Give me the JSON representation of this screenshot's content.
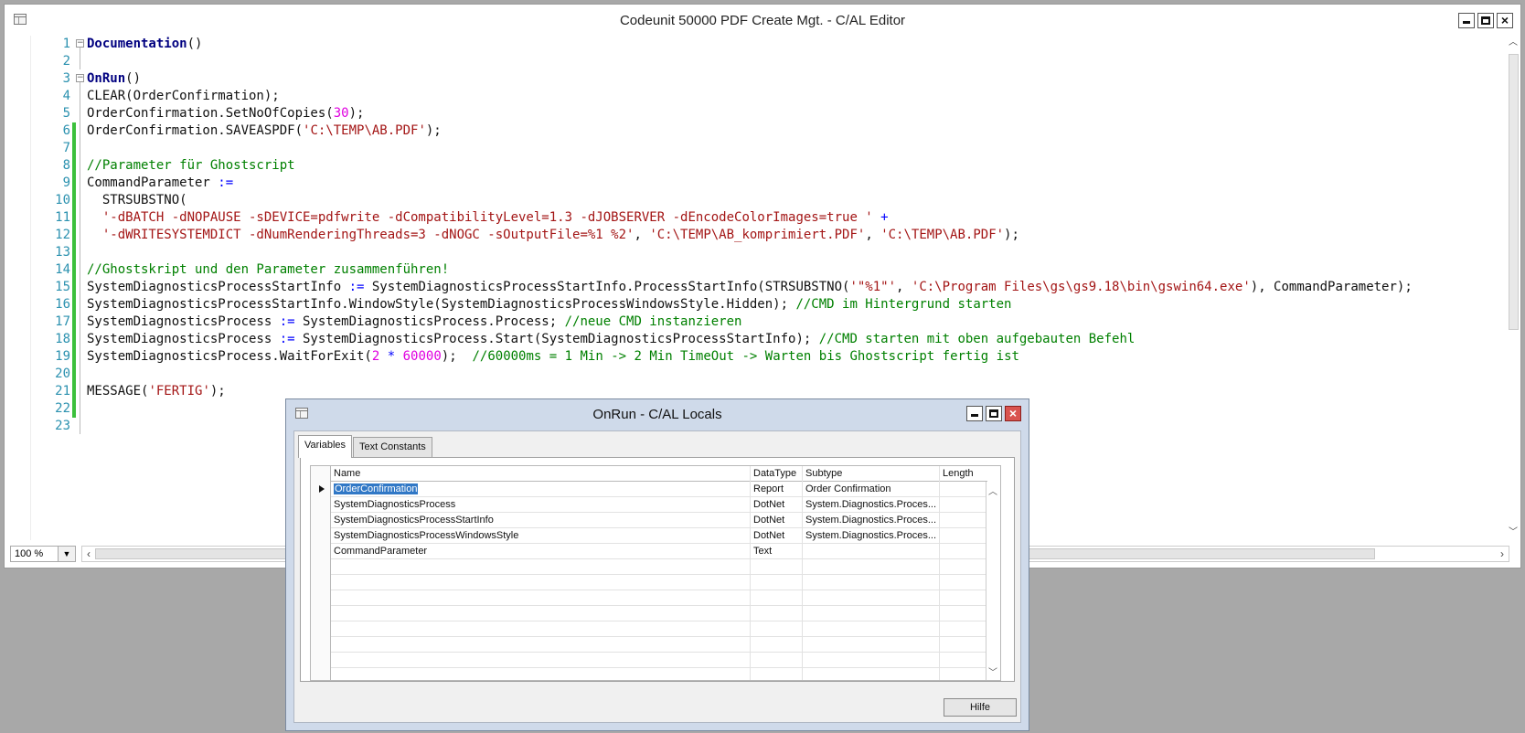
{
  "editor": {
    "title": "Codeunit 50000 PDF Create Mgt. - C/AL Editor",
    "zoom": "100 %",
    "lines": [
      {
        "n": "1",
        "tokens": [
          {
            "t": "Documentation",
            "c": "kw"
          },
          {
            "t": "()",
            "c": ""
          }
        ]
      },
      {
        "n": "2",
        "tokens": []
      },
      {
        "n": "3",
        "tokens": [
          {
            "t": "OnRun",
            "c": "kw"
          },
          {
            "t": "()",
            "c": ""
          }
        ]
      },
      {
        "n": "4",
        "tokens": [
          {
            "t": "CLEAR(OrderConfirmation);",
            "c": ""
          }
        ]
      },
      {
        "n": "5",
        "tokens": [
          {
            "t": "OrderConfirmation.SetNoOfCopies(",
            "c": ""
          },
          {
            "t": "30",
            "c": "num"
          },
          {
            "t": ");",
            "c": ""
          }
        ]
      },
      {
        "n": "6",
        "tokens": [
          {
            "t": "OrderConfirmation.SAVEASPDF(",
            "c": ""
          },
          {
            "t": "'C:\\TEMP\\AB.PDF'",
            "c": "str"
          },
          {
            "t": ");",
            "c": ""
          }
        ]
      },
      {
        "n": "7",
        "tokens": []
      },
      {
        "n": "8",
        "tokens": [
          {
            "t": "//Parameter für Ghostscript",
            "c": "cmt"
          }
        ]
      },
      {
        "n": "9",
        "tokens": [
          {
            "t": "CommandParameter ",
            "c": ""
          },
          {
            "t": ":=",
            "c": "op"
          }
        ]
      },
      {
        "n": "10",
        "tokens": [
          {
            "t": "  STRSUBSTNO(",
            "c": ""
          }
        ]
      },
      {
        "n": "11",
        "tokens": [
          {
            "t": "  '-dBATCH -dNOPAUSE -sDEVICE=pdfwrite -dCompatibilityLevel=1.3 -dJOBSERVER -dEncodeColorImages=true '",
            "c": "str"
          },
          {
            "t": " +",
            "c": "op"
          }
        ]
      },
      {
        "n": "12",
        "tokens": [
          {
            "t": "  '-dWRITESYSTEMDICT -dNumRenderingThreads=3 -dNOGC -sOutputFile=%1 %2'",
            "c": "str"
          },
          {
            "t": ", ",
            "c": ""
          },
          {
            "t": "'C:\\TEMP\\AB_komprimiert.PDF'",
            "c": "str"
          },
          {
            "t": ", ",
            "c": ""
          },
          {
            "t": "'C:\\TEMP\\AB.PDF'",
            "c": "str"
          },
          {
            "t": ");",
            "c": ""
          }
        ]
      },
      {
        "n": "13",
        "tokens": []
      },
      {
        "n": "14",
        "tokens": [
          {
            "t": "//Ghostskript und den Parameter zusammenführen!",
            "c": "cmt"
          }
        ]
      },
      {
        "n": "15",
        "tokens": [
          {
            "t": "SystemDiagnosticsProcessStartInfo ",
            "c": ""
          },
          {
            "t": ":=",
            "c": "op"
          },
          {
            "t": " SystemDiagnosticsProcessStartInfo.ProcessStartInfo(STRSUBSTNO(",
            "c": ""
          },
          {
            "t": "'\"%1\"'",
            "c": "str"
          },
          {
            "t": ", ",
            "c": ""
          },
          {
            "t": "'C:\\Program Files\\gs\\gs9.18\\bin\\gswin64.exe'",
            "c": "str"
          },
          {
            "t": "), CommandParameter);",
            "c": ""
          }
        ]
      },
      {
        "n": "16",
        "tokens": [
          {
            "t": "SystemDiagnosticsProcessStartInfo.WindowStyle(SystemDiagnosticsProcessWindowsStyle.Hidden); ",
            "c": ""
          },
          {
            "t": "//CMD im Hintergrund starten",
            "c": "cmt"
          }
        ]
      },
      {
        "n": "17",
        "tokens": [
          {
            "t": "SystemDiagnosticsProcess ",
            "c": ""
          },
          {
            "t": ":=",
            "c": "op"
          },
          {
            "t": " SystemDiagnosticsProcess.Process; ",
            "c": ""
          },
          {
            "t": "//neue CMD instanzieren",
            "c": "cmt"
          }
        ]
      },
      {
        "n": "18",
        "tokens": [
          {
            "t": "SystemDiagnosticsProcess ",
            "c": ""
          },
          {
            "t": ":=",
            "c": "op"
          },
          {
            "t": " SystemDiagnosticsProcess.Start(SystemDiagnosticsProcessStartInfo); ",
            "c": ""
          },
          {
            "t": "//CMD starten mit oben aufgebauten Befehl",
            "c": "cmt"
          }
        ]
      },
      {
        "n": "19",
        "tokens": [
          {
            "t": "SystemDiagnosticsProcess.WaitForExit(",
            "c": ""
          },
          {
            "t": "2",
            "c": "num"
          },
          {
            "t": " * ",
            "c": "op"
          },
          {
            "t": "60000",
            "c": "num"
          },
          {
            "t": ");  ",
            "c": ""
          },
          {
            "t": "//60000ms = 1 Min -> 2 Min TimeOut -> Warten bis Ghostscript fertig ist",
            "c": "cmt"
          }
        ]
      },
      {
        "n": "20",
        "tokens": []
      },
      {
        "n": "21",
        "tokens": [
          {
            "t": "MESSAGE(",
            "c": ""
          },
          {
            "t": "'FERTIG'",
            "c": "str"
          },
          {
            "t": ");",
            "c": ""
          }
        ]
      },
      {
        "n": "22",
        "tokens": []
      },
      {
        "n": "23",
        "tokens": []
      }
    ],
    "changed_lines": [
      "6",
      "7",
      "8",
      "9",
      "10",
      "11",
      "12",
      "13",
      "14",
      "15",
      "16",
      "17",
      "18",
      "19",
      "20",
      "21",
      "22"
    ],
    "fold_lines": [
      "1",
      "3"
    ]
  },
  "locals": {
    "title": "OnRun - C/AL Locals",
    "tabs": [
      "Variables",
      "Text Constants"
    ],
    "columns": {
      "name": "Name",
      "datatype": "DataType",
      "subtype": "Subtype",
      "length": "Length"
    },
    "rows": [
      {
        "name": "OrderConfirmation",
        "datatype": "Report",
        "subtype": "Order Confirmation",
        "length": ""
      },
      {
        "name": "SystemDiagnosticsProcess",
        "datatype": "DotNet",
        "subtype": "System.Diagnostics.Proces...",
        "length": ""
      },
      {
        "name": "SystemDiagnosticsProcessStartInfo",
        "datatype": "DotNet",
        "subtype": "System.Diagnostics.Proces...",
        "length": ""
      },
      {
        "name": "SystemDiagnosticsProcessWindowsStyle",
        "datatype": "DotNet",
        "subtype": "System.Diagnostics.Proces...",
        "length": ""
      },
      {
        "name": "CommandParameter",
        "datatype": "Text",
        "subtype": "",
        "length": ""
      }
    ],
    "empty_rows": 8,
    "help_label": "Hilfe"
  }
}
